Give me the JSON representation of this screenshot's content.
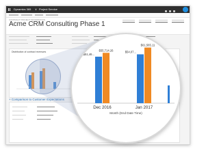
{
  "topbar": {
    "app_name": "Dynamics 365",
    "chevron": "∨",
    "area_name": "Project Service",
    "grid_icon": "waffle-icon",
    "avatar_icon": "user-avatar-icon"
  },
  "header": {
    "breadcrumb": "CONTRACT PROJECT INFORMATION",
    "title": "Acme CRM Consulting Phase 1",
    "chevron": "˅"
  },
  "card": {
    "title": "Distribution of contract revenues"
  },
  "section2": {
    "title": "+ Comparison to Customer Expectations"
  },
  "colors": {
    "series_blue": "#2f7fd6",
    "series_orange": "#f08a24",
    "accent": "#1f6ab5"
  },
  "chart_data": {
    "type": "bar",
    "categories": [
      "Dec 2016",
      "Jan 2017"
    ],
    "xlabel": "Month (End Date Time)",
    "series": [
      {
        "name": "",
        "values": [
          51460,
          54070
        ],
        "labels": [
          "$51,46...",
          "$54,07..."
        ]
      },
      {
        "name": "",
        "values": [
          55714.26,
          61565.11
        ],
        "labels": [
          "$55,714.26",
          "$61,565.11"
        ]
      }
    ]
  }
}
